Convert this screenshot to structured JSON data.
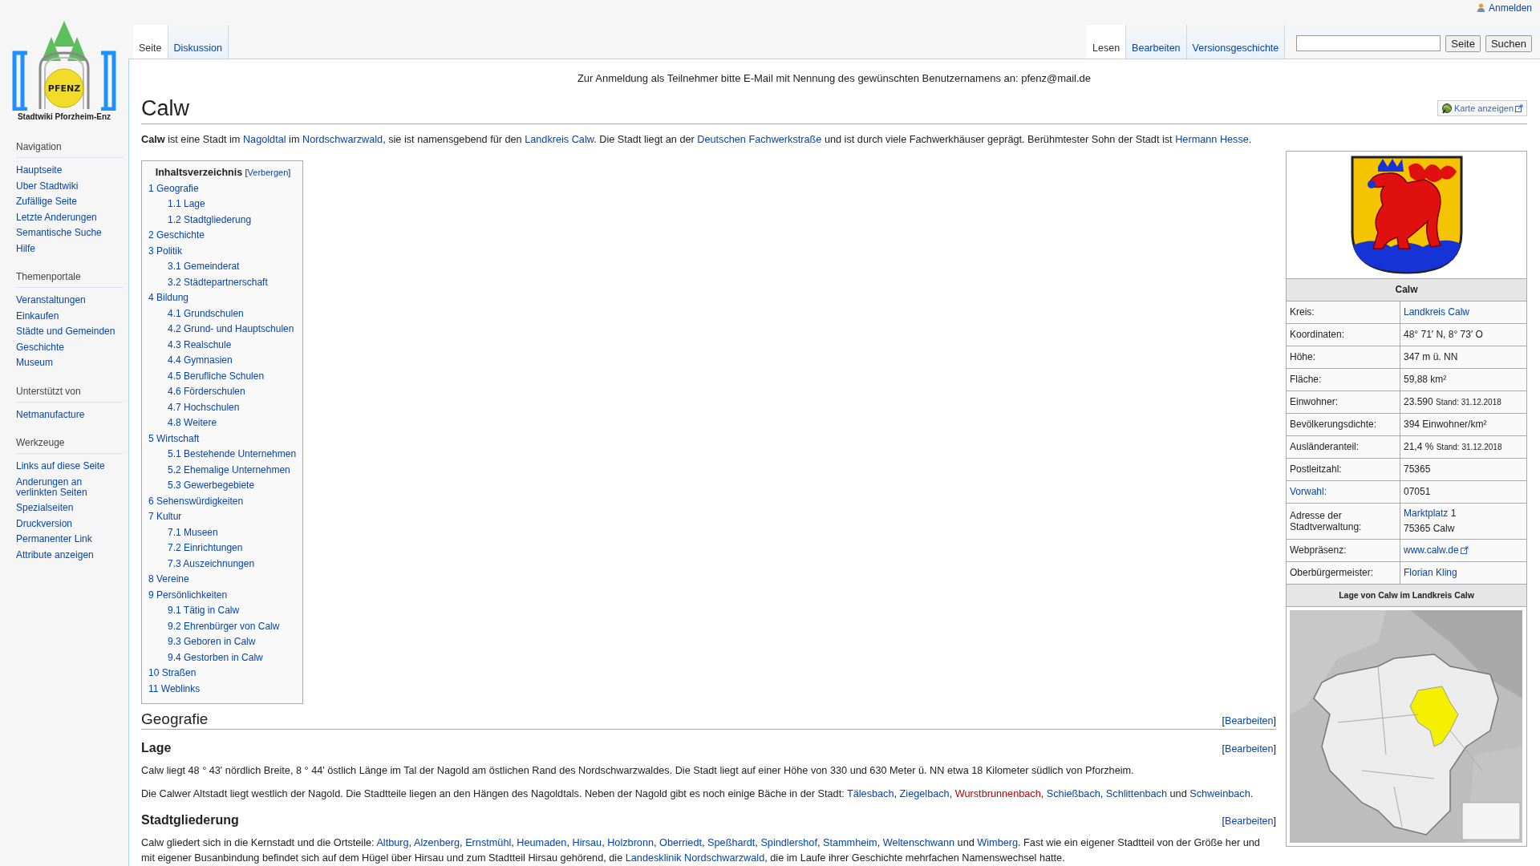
{
  "personal": {
    "login": "Anmelden"
  },
  "logo": {
    "badge": "PFENZ",
    "caption": "Stadtwiki Pforzheim-Enz"
  },
  "sidebar": [
    {
      "heading": "Navigation",
      "items": [
        "Hauptseite",
        "Uber Stadtwiki",
        "Zufällige Seite",
        "Letzte Anderungen",
        "Semantische Suche",
        "Hilfe"
      ]
    },
    {
      "heading": "Themenportale",
      "items": [
        "Veranstaltungen",
        "Einkaufen",
        "Städte und Gemeinden",
        "Geschichte",
        "Museum"
      ]
    },
    {
      "heading": "Unterstützt von",
      "items": [
        "Netmanufacture"
      ]
    },
    {
      "heading": "Werkzeuge",
      "items": [
        "Links auf diese Seite",
        "Anderungen an verlinkten Seiten",
        "Spezialseiten",
        "Druckversion",
        "Permanenter Link",
        "Attribute anzeigen"
      ]
    }
  ],
  "namespace_tabs": [
    {
      "label": "Seite",
      "selected": true
    },
    {
      "label": "Diskussion",
      "selected": false
    }
  ],
  "view_tabs": [
    {
      "label": "Lesen",
      "selected": true
    },
    {
      "label": "Bearbeiten",
      "selected": false
    },
    {
      "label": "Versionsgeschichte",
      "selected": false
    }
  ],
  "search": {
    "buttons": [
      "Seite",
      "Suchen"
    ]
  },
  "sitenotice": "Zur Anmeldung als Teilnehmer bitte E-Mail mit Nennung des gewünschten Benutzernamens an: pfenz@mail.de",
  "title": "Calw",
  "map_button": "Karte anzeigen",
  "intro": [
    {
      "kind": "bold",
      "text": "Calw"
    },
    {
      "kind": "text",
      "text": " ist eine Stadt im "
    },
    {
      "kind": "link",
      "text": "Nagoldtal"
    },
    {
      "kind": "text",
      "text": " im "
    },
    {
      "kind": "link",
      "text": "Nordschwarzwald"
    },
    {
      "kind": "text",
      "text": ", sie ist namensgebend für den "
    },
    {
      "kind": "link",
      "text": "Landkreis Calw"
    },
    {
      "kind": "text",
      "text": ". Die Stadt liegt an der "
    },
    {
      "kind": "link",
      "text": "Deutschen Fachwerkstraße"
    },
    {
      "kind": "text",
      "text": " und ist durch viele Fachwerkhäuser geprägt. Berühmtester Sohn der Stadt ist "
    },
    {
      "kind": "link",
      "text": "Hermann Hesse"
    },
    {
      "kind": "text",
      "text": "."
    }
  ],
  "toc": {
    "title": "Inhaltsverzeichnis",
    "toggle": [
      "[",
      "Verbergen",
      "]"
    ],
    "items": [
      {
        "number": "1",
        "label": "Geografie",
        "children": [
          {
            "number": "1.1",
            "label": "Lage"
          },
          {
            "number": "1.2",
            "label": "Stadtgliederung"
          }
        ]
      },
      {
        "number": "2",
        "label": "Geschichte"
      },
      {
        "number": "3",
        "label": "Politik",
        "children": [
          {
            "number": "3.1",
            "label": "Gemeinderat"
          },
          {
            "number": "3.2",
            "label": "Städtepartnerschaft"
          }
        ]
      },
      {
        "number": "4",
        "label": "Bildung",
        "children": [
          {
            "number": "4.1",
            "label": "Grundschulen"
          },
          {
            "number": "4.2",
            "label": "Grund- und Hauptschulen"
          },
          {
            "number": "4.3",
            "label": "Realschule"
          },
          {
            "number": "4.4",
            "label": "Gymnasien"
          },
          {
            "number": "4.5",
            "label": "Berufliche Schulen"
          },
          {
            "number": "4.6",
            "label": "Förderschulen"
          },
          {
            "number": "4.7",
            "label": "Hochschulen"
          },
          {
            "number": "4.8",
            "label": "Weitere"
          }
        ]
      },
      {
        "number": "5",
        "label": "Wirtschaft",
        "children": [
          {
            "number": "5.1",
            "label": "Bestehende Unternehmen"
          },
          {
            "number": "5.2",
            "label": "Ehemalige Unternehmen"
          },
          {
            "number": "5.3",
            "label": "Gewerbegebiete"
          }
        ]
      },
      {
        "number": "6",
        "label": "Sehenswürdigkeiten"
      },
      {
        "number": "7",
        "label": "Kultur",
        "children": [
          {
            "number": "7.1",
            "label": "Museen"
          },
          {
            "number": "7.2",
            "label": "Einrichtungen"
          },
          {
            "number": "7.3",
            "label": "Auszeichnungen"
          }
        ]
      },
      {
        "number": "8",
        "label": "Vereine"
      },
      {
        "number": "9",
        "label": "Persönlichkeiten",
        "children": [
          {
            "number": "9.1",
            "label": "Tätig in Calw"
          },
          {
            "number": "9.2",
            "label": "Ehrenbürger von Calw"
          },
          {
            "number": "9.3",
            "label": "Geboren in Calw"
          },
          {
            "number": "9.4",
            "label": "Gestorben in Calw"
          }
        ]
      },
      {
        "number": "10",
        "label": "Straßen"
      },
      {
        "number": "11",
        "label": "Weblinks"
      }
    ]
  },
  "infobox": {
    "title": "Calw",
    "map_caption": "Lage von Calw im Landkreis Calw",
    "rows": [
      {
        "label": {
          "text": "Kreis:",
          "link": false
        },
        "lines": [
          [
            {
              "kind": "link",
              "text": "Landkreis Calw"
            }
          ]
        ]
      },
      {
        "label": {
          "text": "Koordinaten:",
          "link": false
        },
        "lines": [
          [
            {
              "kind": "text",
              "text": "48° 71′ N, 8° 73′ O"
            }
          ]
        ]
      },
      {
        "label": {
          "text": "Höhe:",
          "link": false
        },
        "lines": [
          [
            {
              "kind": "text",
              "text": "347 m ü. NN"
            }
          ]
        ]
      },
      {
        "label": {
          "text": "Fläche:",
          "link": false
        },
        "lines": [
          [
            {
              "kind": "text",
              "text": "59,88 km²"
            }
          ]
        ]
      },
      {
        "label": {
          "text": "Einwohner:",
          "link": false
        },
        "lines": [
          [
            {
              "kind": "text",
              "text": "23.590 "
            },
            {
              "kind": "small",
              "text": "Stand: 31.12.2018"
            }
          ]
        ]
      },
      {
        "label": {
          "text": "Bevölkerungsdichte:",
          "link": false
        },
        "lines": [
          [
            {
              "kind": "text",
              "text": "394 Einwohner/km²"
            }
          ]
        ]
      },
      {
        "label": {
          "text": "Ausländeranteil:",
          "link": false
        },
        "lines": [
          [
            {
              "kind": "text",
              "text": "21,4 % "
            },
            {
              "kind": "small",
              "text": "Stand: 31.12.2018"
            }
          ]
        ]
      },
      {
        "label": {
          "text": "Postleitzahl:",
          "link": false
        },
        "lines": [
          [
            {
              "kind": "text",
              "text": "75365"
            }
          ]
        ]
      },
      {
        "label": {
          "text": "Vorwahl:",
          "link": true
        },
        "lines": [
          [
            {
              "kind": "text",
              "text": "07051"
            }
          ]
        ]
      },
      {
        "label": {
          "text": "Adresse der Stadtverwaltung:",
          "link": false
        },
        "lines": [
          [
            {
              "kind": "link",
              "text": "Marktplatz"
            },
            {
              "kind": "text",
              "text": " 1"
            }
          ],
          [
            {
              "kind": "text",
              "text": "75365 Calw"
            }
          ]
        ]
      },
      {
        "label": {
          "text": "Webpräsenz:",
          "link": false
        },
        "lines": [
          [
            {
              "kind": "ext",
              "text": "www.calw.de"
            }
          ]
        ]
      },
      {
        "label": {
          "text": "Oberbürgermeister:",
          "link": false
        },
        "lines": [
          [
            {
              "kind": "link",
              "text": "Florian Kling"
            }
          ]
        ]
      }
    ]
  },
  "sections": [
    {
      "kind": "section",
      "heading": "Geografie",
      "edit": [
        "[",
        "Bearbeiten",
        "]"
      ]
    },
    {
      "kind": "subsection",
      "heading": "Lage",
      "edit": [
        "[",
        "Bearbeiten",
        "]"
      ],
      "paragraphs": [
        [
          {
            "kind": "text",
            "text": "Calw liegt 48 ° 43' nördlich Breite, 8 ° 44' östlich Länge im Tal der Nagold am östlichen Rand des Nordschwarzwaldes. Die Stadt liegt auf einer Höhe von 330 und 630 Meter ü. NN etwa 18 Kilometer südlich von Pforzheim."
          }
        ],
        [
          {
            "kind": "text",
            "text": "Die Calwer Altstadt liegt westlich der Nagold. Die Stadtteile liegen an den Hängen des Nagoldtals. Neben der Nagold gibt es noch einige Bäche in der Stadt: "
          },
          {
            "kind": "link",
            "text": "Tälesbach"
          },
          {
            "kind": "text",
            "text": ", "
          },
          {
            "kind": "link",
            "text": "Ziegelbach"
          },
          {
            "kind": "text",
            "text": ", "
          },
          {
            "kind": "redlink",
            "text": "Wurstbrunnenbach"
          },
          {
            "kind": "text",
            "text": ", "
          },
          {
            "kind": "link",
            "text": "Schießbach"
          },
          {
            "kind": "text",
            "text": ", "
          },
          {
            "kind": "link",
            "text": "Schlittenbach"
          },
          {
            "kind": "text",
            "text": " und "
          },
          {
            "kind": "link",
            "text": "Schweinbach"
          },
          {
            "kind": "text",
            "text": "."
          }
        ]
      ]
    },
    {
      "kind": "subsection",
      "heading": "Stadtgliederung",
      "edit": [
        "[",
        "Bearbeiten",
        "]"
      ],
      "paragraphs": [
        [
          {
            "kind": "text",
            "text": "Calw gliedert sich in die Kernstadt und die Ortsteile: "
          },
          {
            "kind": "link",
            "text": "Altburg"
          },
          {
            "kind": "text",
            "text": ", "
          },
          {
            "kind": "link",
            "text": "Alzenberg"
          },
          {
            "kind": "text",
            "text": ", "
          },
          {
            "kind": "link",
            "text": "Ernstmühl"
          },
          {
            "kind": "text",
            "text": ", "
          },
          {
            "kind": "link",
            "text": "Heumaden"
          },
          {
            "kind": "text",
            "text": ", "
          },
          {
            "kind": "link",
            "text": "Hirsau"
          },
          {
            "kind": "text",
            "text": ", "
          },
          {
            "kind": "link",
            "text": "Holzbronn"
          },
          {
            "kind": "text",
            "text": ", "
          },
          {
            "kind": "link",
            "text": "Oberriedt"
          },
          {
            "kind": "text",
            "text": ", "
          },
          {
            "kind": "link",
            "text": "Speßhardt"
          },
          {
            "kind": "text",
            "text": ", "
          },
          {
            "kind": "link",
            "text": "Spindlershof"
          },
          {
            "kind": "text",
            "text": ", "
          },
          {
            "kind": "link",
            "text": "Stammheim"
          },
          {
            "kind": "text",
            "text": ", "
          },
          {
            "kind": "link",
            "text": "Weltenschwann"
          },
          {
            "kind": "text",
            "text": " und "
          },
          {
            "kind": "link",
            "text": "Wimberg"
          },
          {
            "kind": "text",
            "text": ". Fast wie ein eigener Stadtteil von der Größe her und mit eigener Busanbindung befindet sich auf dem Hügel über Hirsau und zum Stadtteil Hirsau gehörend, die "
          },
          {
            "kind": "link",
            "text": "Landesklinik Nordschwarzwald"
          },
          {
            "kind": "text",
            "text": ", die im Laufe ihrer Geschichte mehrfachen Namenswechsel hatte."
          }
        ]
      ]
    }
  ]
}
